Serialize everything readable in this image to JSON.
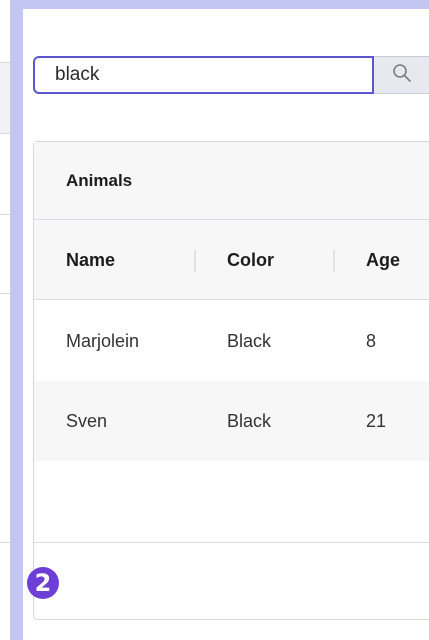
{
  "search": {
    "value": "black",
    "placeholder": ""
  },
  "grid": {
    "title": "Animals",
    "columns": [
      "Name",
      "Color",
      "Age"
    ],
    "rows": [
      {
        "name": "Marjolein",
        "color": "Black",
        "age": "8"
      },
      {
        "name": "Sven",
        "color": "Black",
        "age": "21"
      }
    ]
  },
  "step_badge": "2",
  "icons": {
    "search_button": "search-icon"
  },
  "colors": {
    "accent": "#5b55cf",
    "badge": "#6d3fd6",
    "frame": "#c4c6f2"
  }
}
